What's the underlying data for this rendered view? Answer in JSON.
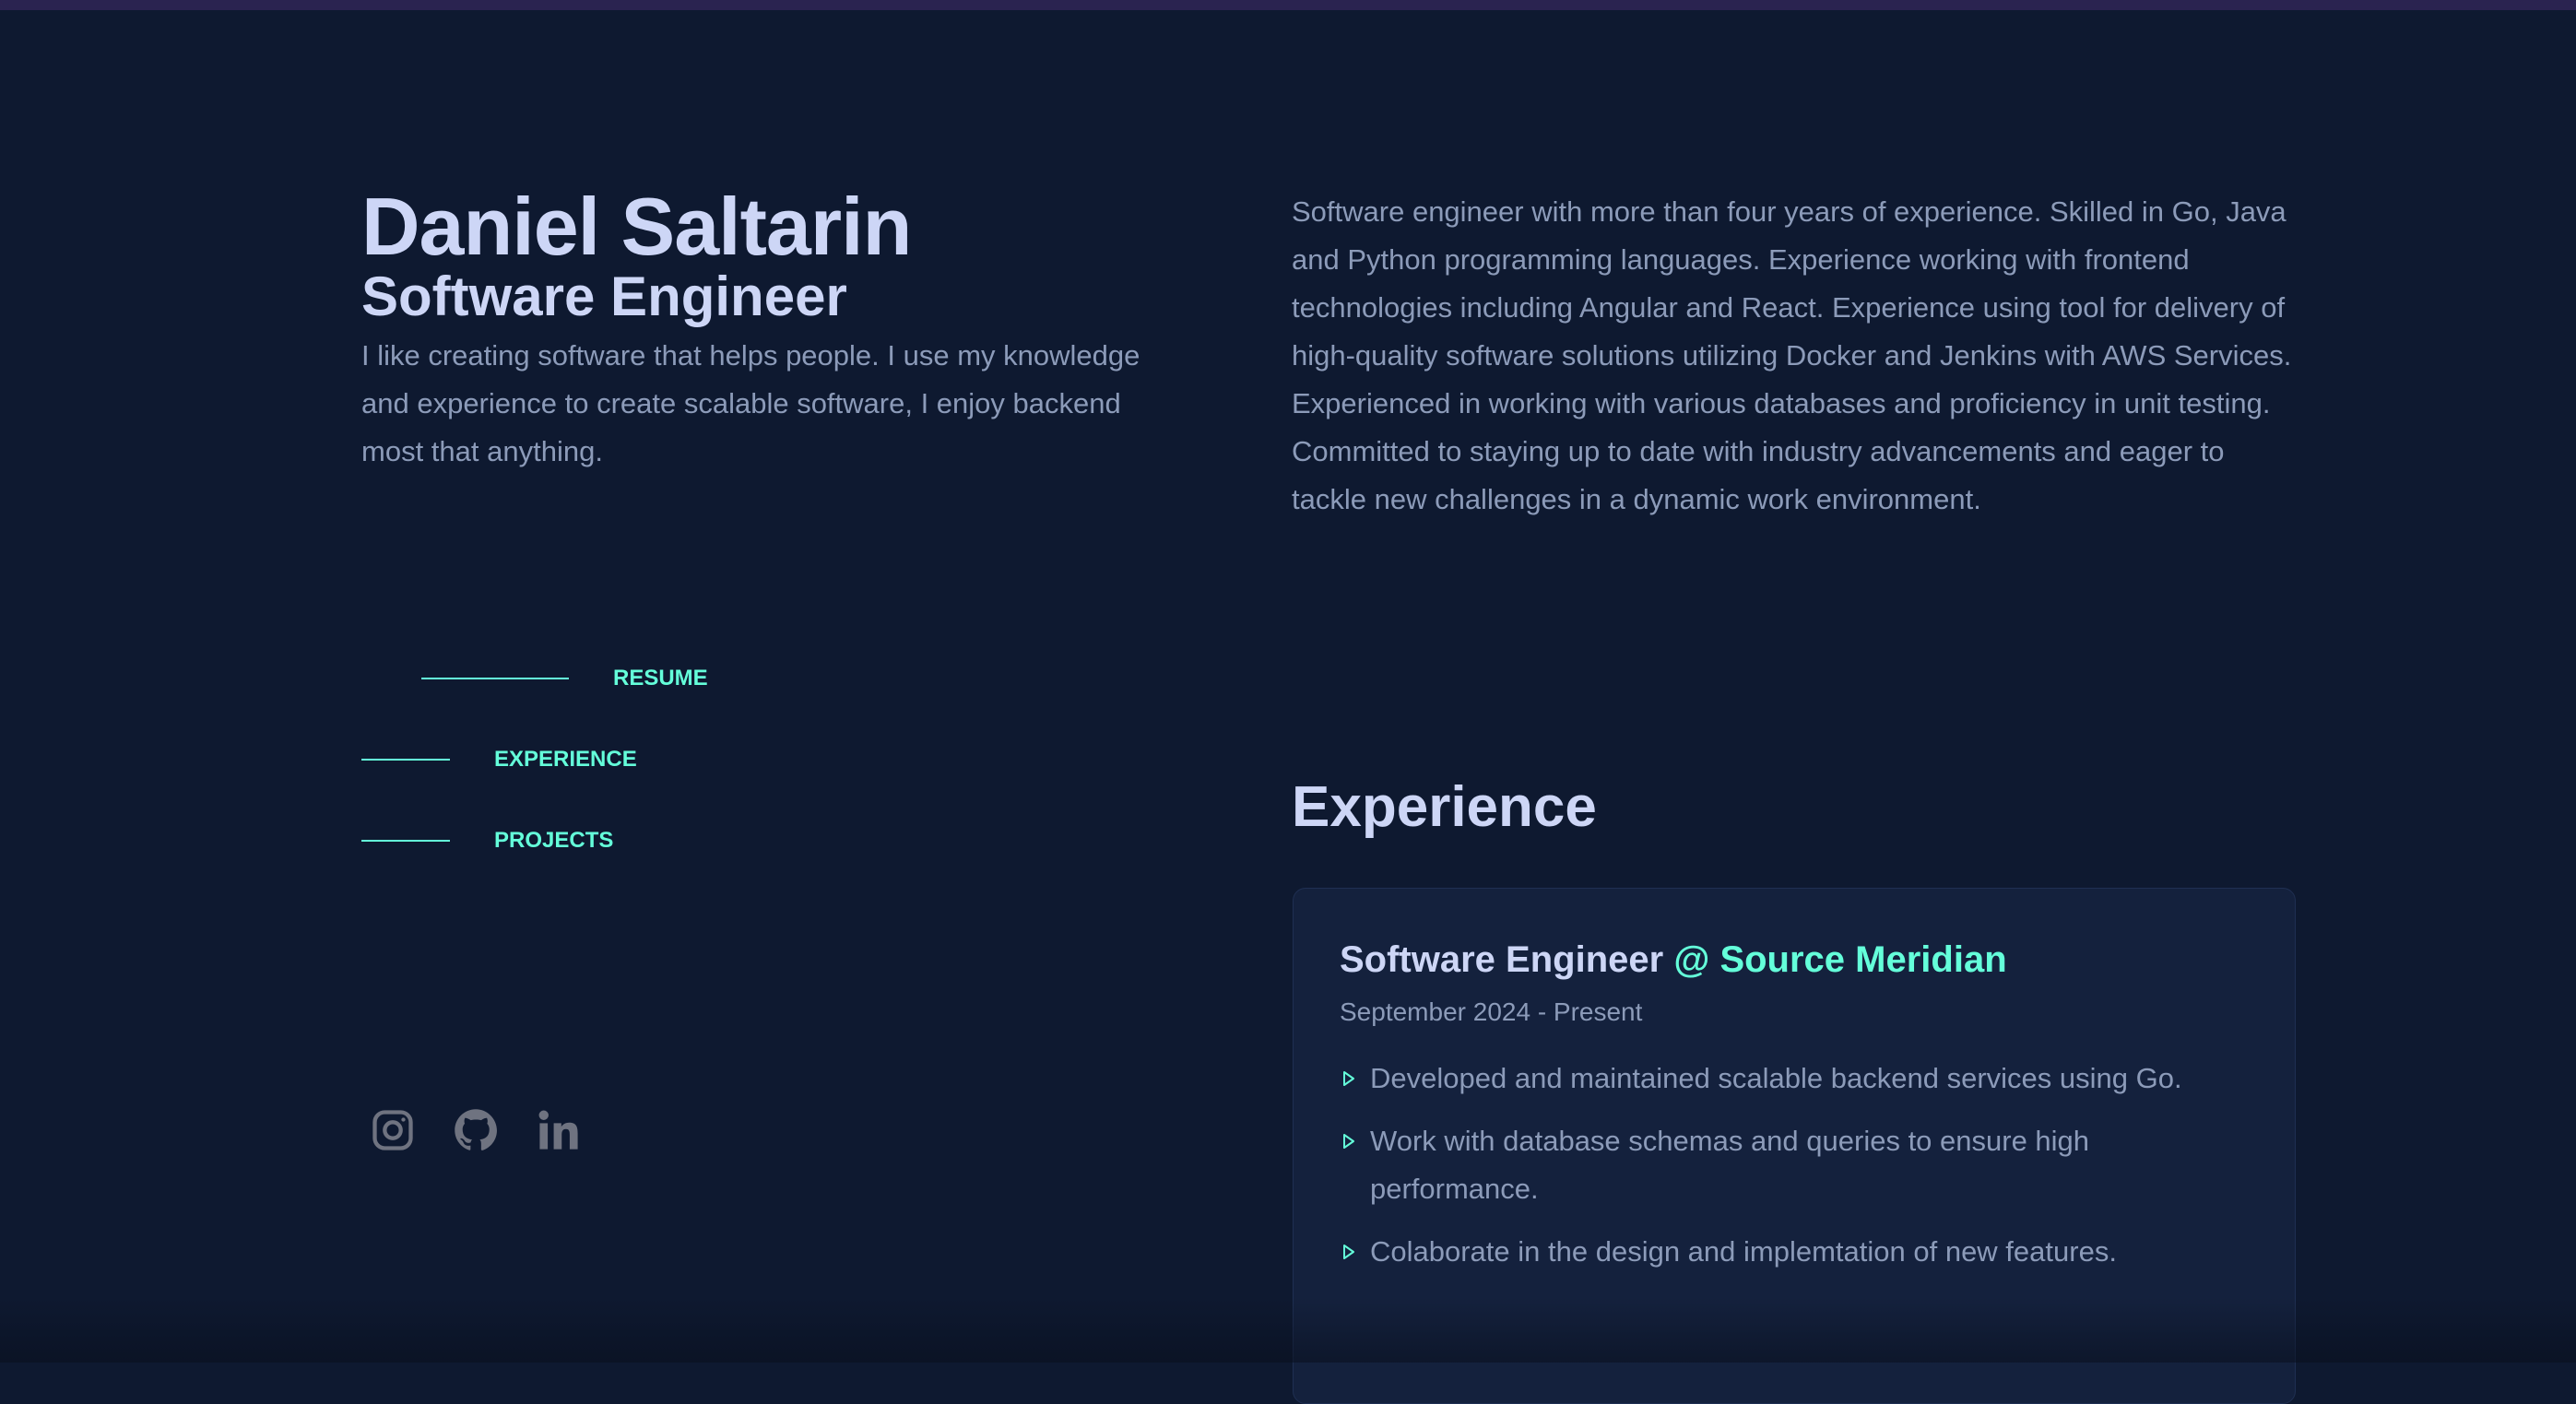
{
  "header": {
    "name": "Daniel Saltarin",
    "role": "Software Engineer",
    "tagline": "I like creating software that helps people. I use my knowledge and experience to create scalable software, I enjoy backend most that anything."
  },
  "nav": {
    "items": [
      {
        "label": "RESUME",
        "active": true
      },
      {
        "label": "EXPERIENCE",
        "active": false
      },
      {
        "label": "PROJECTS",
        "active": false
      }
    ]
  },
  "social": [
    {
      "icon": "instagram-icon"
    },
    {
      "icon": "github-icon"
    },
    {
      "icon": "linkedin-icon"
    }
  ],
  "about": {
    "text": "Software engineer with more than four years of experience. Skilled in Go, Java and Python programming languages. Experience working with frontend technologies including Angular and React. Experience using tool for delivery of high-quality software solutions utilizing Docker and Jenkins with AWS Services. Experienced in working with various databases and proficiency in unit testing. Committed to staying up to date with industry advancements and eager to tackle new challenges in a dynamic work environment."
  },
  "experience": {
    "section_title": "Experience",
    "jobs": [
      {
        "title": "Software Engineer",
        "company": "@ Source Meridian",
        "dates": "September 2024 - Present",
        "bullets": [
          "Developed and maintained scalable backend services using Go.",
          "Work with database schemas and queries to ensure high performance.",
          "Colaborate in the design and implemtation of new features."
        ]
      }
    ]
  },
  "colors": {
    "background": "#0e1930",
    "accent": "#64ffda",
    "heading": "#cdd6f6",
    "body_text": "#8c9bb9",
    "card": "#14213d",
    "top_bar": "#2a2350"
  }
}
